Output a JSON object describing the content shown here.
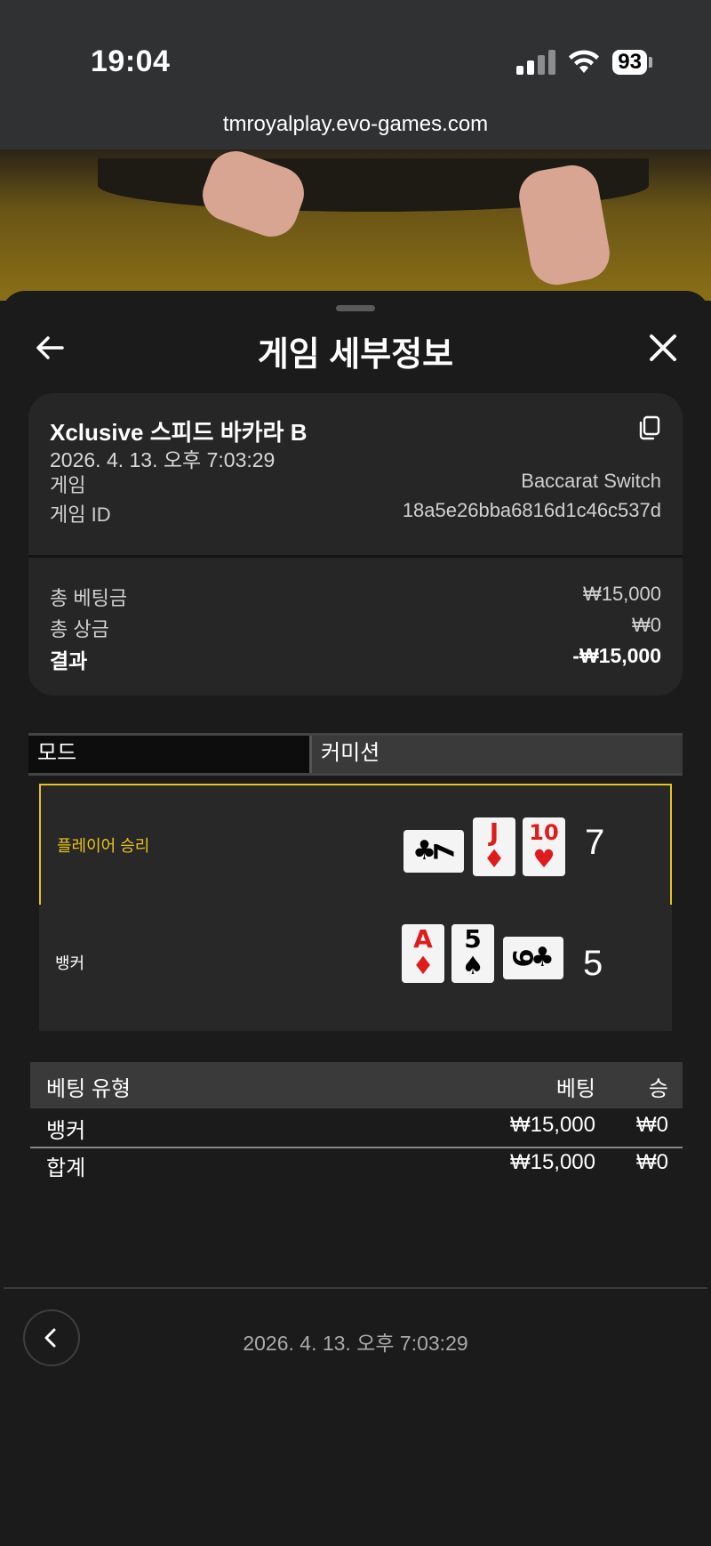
{
  "status_bar": {
    "time": "19:04",
    "battery": "93"
  },
  "browser": {
    "url": "tmroyalplay.evo-games.com"
  },
  "header": {
    "title": "게임 세부정보"
  },
  "game": {
    "name": "Xclusive 스피드 바카라 B",
    "datetime": "2026. 4. 13. 오후 7:03:29",
    "game_label": "게임",
    "game_value": "Baccarat Switch",
    "id_label": "게임 ID",
    "id_value": "18a5e26bba6816d1c46c537d"
  },
  "summary": {
    "total_bet_label": "총 베팅금",
    "total_bet_value": "₩15,000",
    "total_win_label": "총 상금",
    "total_win_value": "₩0",
    "result_label": "결과",
    "result_value": "-₩15,000"
  },
  "tabs": {
    "mode": "모드",
    "commission": "커미션"
  },
  "results": {
    "player": {
      "label": "플레이어 승리",
      "score": "7",
      "cards": [
        {
          "rank": "7",
          "suit": "♣",
          "color": "black",
          "orientation": "sideways"
        },
        {
          "rank": "J",
          "suit": "♦",
          "color": "red",
          "orientation": "upright"
        },
        {
          "rank": "10",
          "suit": "♥",
          "color": "red",
          "orientation": "upright"
        }
      ]
    },
    "banker": {
      "label": "뱅커",
      "score": "5",
      "cards": [
        {
          "rank": "A",
          "suit": "♦",
          "color": "red",
          "orientation": "upright"
        },
        {
          "rank": "5",
          "suit": "♠",
          "color": "black",
          "orientation": "upright"
        },
        {
          "rank": "9",
          "suit": "♣",
          "color": "black",
          "orientation": "sideways"
        }
      ]
    }
  },
  "bets": {
    "headers": {
      "type": "베팅 유형",
      "bet": "베팅",
      "win": "승"
    },
    "rows": [
      {
        "type": "뱅커",
        "bet": "₩15,000",
        "win": "₩0"
      }
    ],
    "total": {
      "type": "합계",
      "bet": "₩15,000",
      "win": "₩0"
    }
  },
  "footer": {
    "datetime": "2026. 4. 13. 오후 7:03:29"
  },
  "colors": {
    "accent": "#e6c21a",
    "sheet_bg": "#1b1b1b",
    "card_bg": "#262626"
  }
}
